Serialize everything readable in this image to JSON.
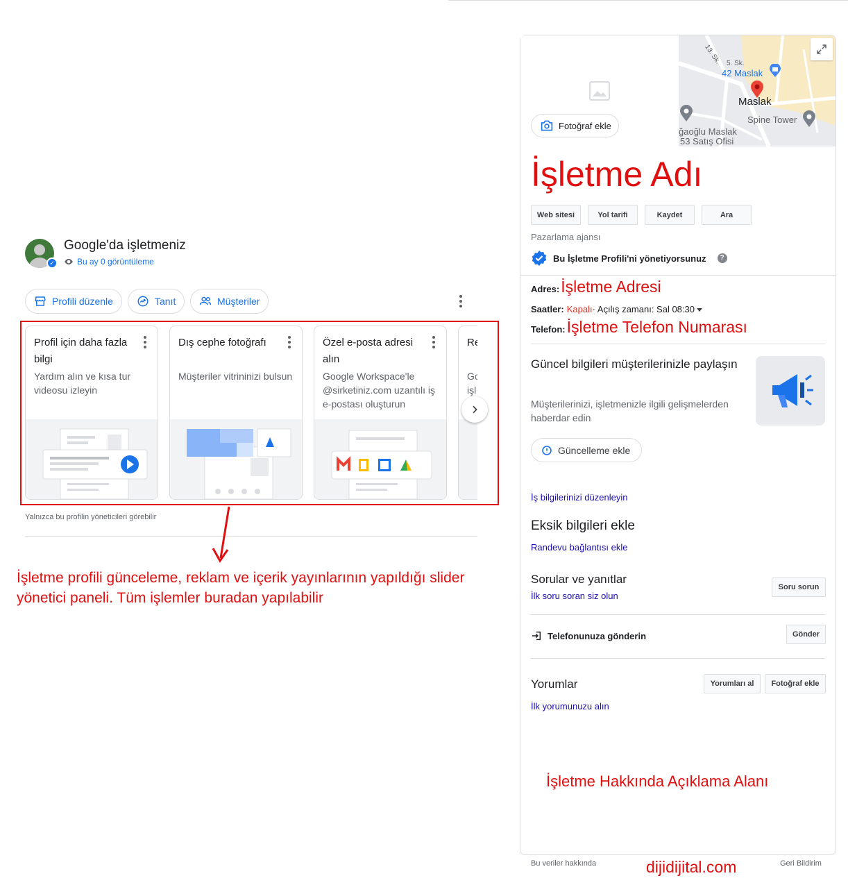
{
  "left": {
    "business_title": "Google'da işletmeniz",
    "views": "Bu ay 0 görüntüleme",
    "chips": [
      "Profili düzenle",
      "Tanıt",
      "Müşteriler"
    ],
    "cards": [
      {
        "title": "Profil için daha fazla bilgi",
        "desc": "Yardım alın ve kısa tur videosu izleyin"
      },
      {
        "title": "Dış cephe fotoğrafı",
        "desc": "Müşteriler vitrininizi bulsun"
      },
      {
        "title": "Özel e-posta adresi alın",
        "desc": "Google Workspace'le @sirketiniz.com uzantılı iş e-postası oluşturun"
      }
    ],
    "partial_card": {
      "title": "Re",
      "desc_line1": "Gc",
      "desc_line2": "işl"
    },
    "only_admins_note": "Yalnızca bu profilin yöneticileri görebilir",
    "annotation": "İşletme profili günceleme, reklam ve içerik yayınlarının yapıldığı slider yönetici paneli. Tüm işlemler buradan yapılabilir"
  },
  "panel": {
    "add_photo": "Fotoğraf ekle",
    "map_labels": {
      "street1": "13. Sk.",
      "street2": "5. Sk.",
      "poi1": "42 Maslak",
      "center": "Maslak",
      "poi2": "Spine Tower",
      "poi3_line1": "ğaoğlu Maslak",
      "poi3_line2": "53 Satış Ofisi"
    },
    "business_name": "İşletme Adı",
    "actions": [
      "Web sitesi",
      "Yol tarifi",
      "Kaydet",
      "Ara"
    ],
    "category": "Pazarlama ajansı",
    "managed_text": "Bu İşletme Profili'ni yönetiyorsunuz",
    "address_label": "Adres:",
    "address_value": "İşletme Adresi",
    "hours_label": "Saatler:",
    "hours_status": "Kapalı",
    "hours_rest": " · Açılış zamanı: Sal 08:30",
    "phone_label": "Telefon:",
    "phone_value": "İşletme Telefon Numarası",
    "update_title": "Güncel bilgileri müşterilerinizle paylaşın",
    "update_desc": "Müşterilerinizi, işletmenizle ilgili gelişmelerden haberdar edin",
    "add_update": "Güncelleme ekle",
    "edit_info_link": "İş bilgilerinizi düzenleyin",
    "missing_title": "Eksik bilgileri ekle",
    "appointment_link": "Randevu bağlantısı ekle",
    "qa_title": "Sorular ve yanıtlar",
    "qa_link": "İlk soru soran siz olun",
    "ask_btn": "Soru sorun",
    "send_phone": "Telefonunuza gönderin",
    "send_btn": "Gönder",
    "reviews_title": "Yorumlar",
    "get_reviews_btn": "Yorumları al",
    "add_photo_btn": "Fotoğraf ekle",
    "first_review_link": "İlk yorumunuzu alın",
    "about_area": "İşletme Hakkında Açıklama Alanı"
  },
  "footer": {
    "about_data": "Bu veriler hakkında",
    "brand": "dijidijital.com",
    "feedback": "Geri Bildirim"
  },
  "colors": {
    "accent": "#1a73e8",
    "annotation_red": "#e01010",
    "link": "#1a0dab"
  }
}
